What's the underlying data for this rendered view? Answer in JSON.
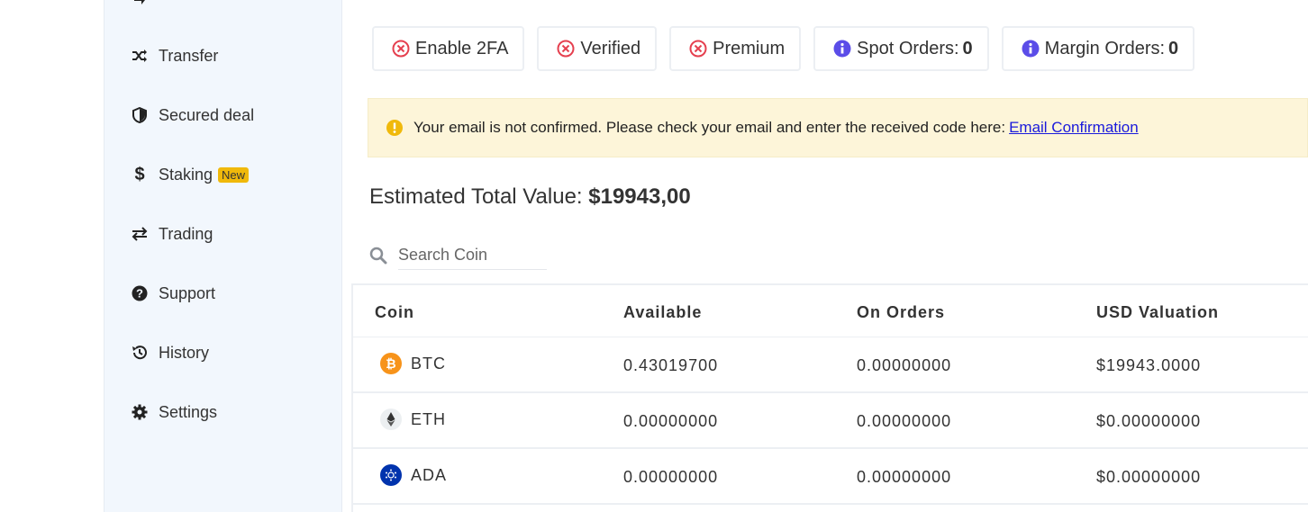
{
  "sidebar": {
    "items": [
      {
        "label": "Transfer",
        "icon": "shuffle-icon"
      },
      {
        "label": "Secured deal",
        "icon": "shield-icon"
      },
      {
        "label": "Staking",
        "icon": "dollar-icon",
        "badge": "New"
      },
      {
        "label": "Trading",
        "icon": "exchange-arrows-icon"
      },
      {
        "label": "Support",
        "icon": "question-circle-icon"
      },
      {
        "label": "History",
        "icon": "history-icon"
      },
      {
        "label": "Settings",
        "icon": "gear-icon"
      }
    ]
  },
  "status": {
    "enable_2fa": "Enable 2FA",
    "verified": "Verified",
    "premium": "Premium",
    "spot_orders_label": "Spot Orders:",
    "spot_orders_value": "0",
    "margin_orders_label": "Margin Orders:",
    "margin_orders_value": "0"
  },
  "alert": {
    "message": "Your email is not confirmed. Please check your email and enter the received code here:",
    "link": "Email Confirmation"
  },
  "estimate": {
    "label": "Estimated Total Value:",
    "value": "$19943,00"
  },
  "search": {
    "placeholder": "Search Coin"
  },
  "table": {
    "headers": [
      "Coin",
      "Available",
      "On Orders",
      "USD Valuation"
    ],
    "rows": [
      {
        "coin": "BTC",
        "available": "0.43019700",
        "on_orders": "0.00000000",
        "usd": "$19943.0000"
      },
      {
        "coin": "ETH",
        "available": "0.00000000",
        "on_orders": "0.00000000",
        "usd": "$0.00000000"
      },
      {
        "coin": "ADA",
        "available": "0.00000000",
        "on_orders": "0.00000000",
        "usd": "$0.00000000"
      }
    ]
  },
  "colors": {
    "error_red": "#e5404f",
    "info_purple": "#5b4de8",
    "warning_yellow": "#f0b90b",
    "btc_orange": "#f7931a",
    "ada_blue": "#0033ad"
  }
}
